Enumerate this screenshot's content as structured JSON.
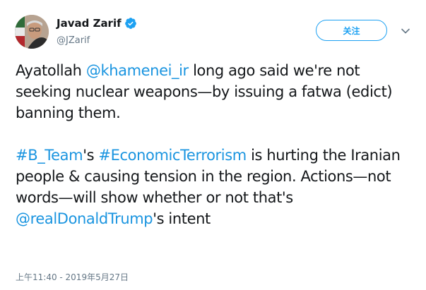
{
  "user": {
    "display_name": "Javad Zarif",
    "handle": "@JZarif"
  },
  "follow_button_label": "关注",
  "tweet": {
    "p1_a": "Ayatollah ",
    "mention_khamenei": "@khamenei_ir",
    "p1_b": " long ago said we're not seeking nuclear weapons—by issuing a fatwa (edict) banning them.",
    "hashtag_bteam": "#B_Team",
    "p2_a": "'s ",
    "hashtag_econ": "#EconomicTerrorism",
    "p2_b": " is hurting the Iranian people & causing tension in the region. Actions—not words—will show whether or not that's ",
    "mention_trump": "@realDonaldTrump",
    "p2_c": "'s intent"
  },
  "timestamp": "上午11:40 - 2019年5月27日",
  "colors": {
    "link": "#1b95e0",
    "follow_border": "#1da1f2",
    "muted": "#657786",
    "verified": "#1da1f2"
  },
  "icons": {
    "verified": "verified-badge-icon",
    "caret": "chevron-down-icon"
  }
}
